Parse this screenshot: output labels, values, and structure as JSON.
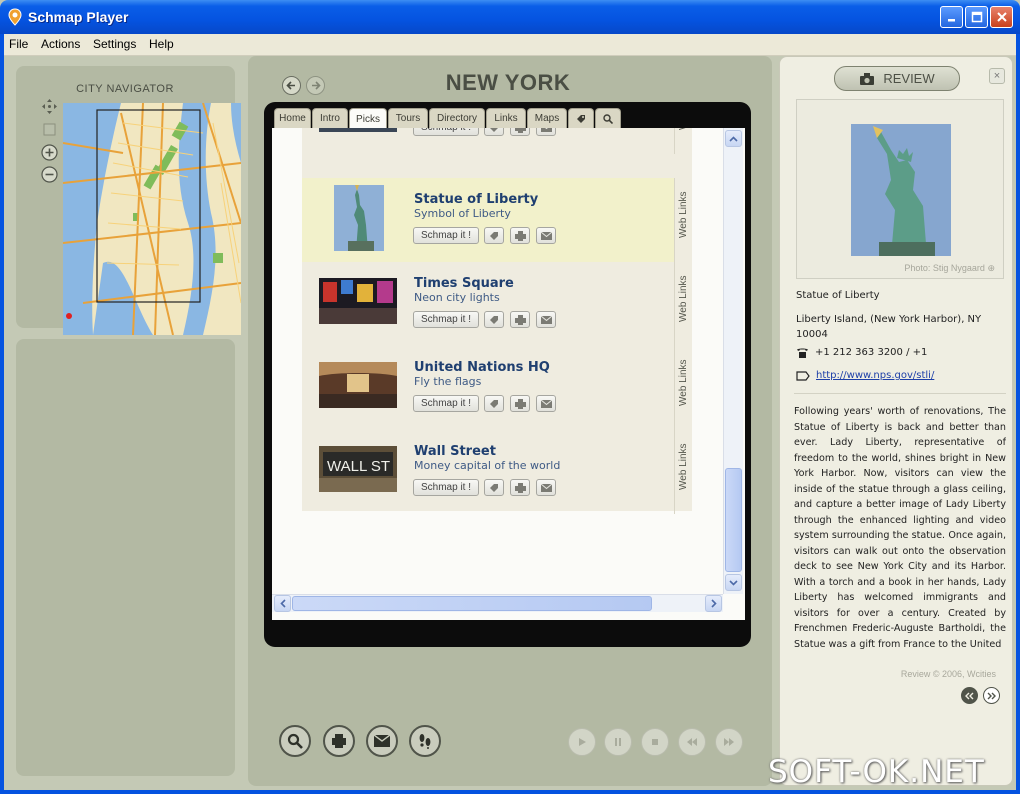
{
  "window": {
    "title": "Schmap Player"
  },
  "menu": [
    "File",
    "Actions",
    "Settings",
    "Help"
  ],
  "navigator": {
    "title": "CITY NAVIGATOR"
  },
  "center": {
    "city": "NEW YORK",
    "tabs": [
      "Home",
      "Intro",
      "Picks",
      "Tours",
      "Directory",
      "Links",
      "Maps"
    ],
    "active_tab": "Picks",
    "schmap_label": "Schmap it !",
    "weblinks_label": "Web Links",
    "items": [
      {
        "title": "Statue of Liberty",
        "subtitle": "Symbol of Liberty",
        "selected": true
      },
      {
        "title": "Times Square",
        "subtitle": "Neon city lights",
        "selected": false
      },
      {
        "title": "United Nations HQ",
        "subtitle": "Fly the flags",
        "selected": false
      },
      {
        "title": "Wall Street",
        "subtitle": "Money capital of the world",
        "selected": false
      }
    ],
    "wall_sign": "WALL ST"
  },
  "review": {
    "button_label": "REVIEW",
    "close": "×",
    "photo_credit": "Photo: Stig Nygaard",
    "place_name": "Statue of Liberty",
    "address": "Liberty Island, (New York Harbor), NY 10004",
    "phone": "+1 212 363 3200 / +1",
    "url": "http://www.nps.gov/stli/",
    "body": "Following years' worth of renovations, The Statue of Liberty is back and better than ever. Lady Liberty, representative of freedom to the world, shines bright in New York Harbor. Now, visitors can view the inside of the statue through a glass ceiling, and capture a better image of Lady Liberty through the enhanced lighting and video system surrounding the statue. Once again, visitors can walk out onto the observation deck to see New York City and its Harbor. With a torch and a book in her hands, Lady Liberty has welcomed immigrants and visitors for over a century. Created by Frenchmen Frederic-Auguste Bartholdi, the Statue was a gift from France to the United",
    "copyright": "Review © 2006, Wcities"
  },
  "watermark": "SOFT-OK.NET",
  "colors": {
    "title_blue": "#0553e0",
    "panel": "#b3b9a3",
    "selected_row": "#f2f1cb",
    "link": "#1d3fa8"
  }
}
